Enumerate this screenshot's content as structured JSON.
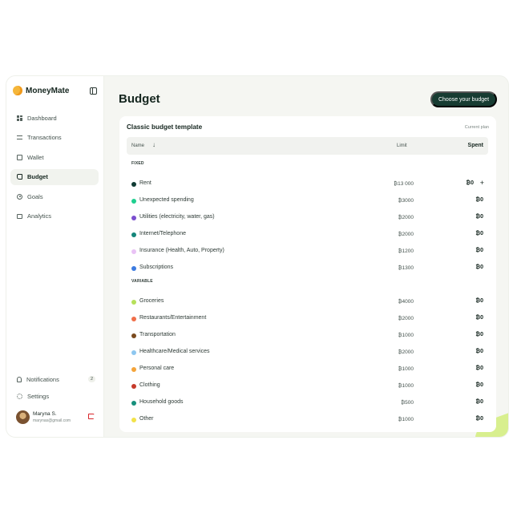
{
  "app": {
    "name": "MoneyMate"
  },
  "sidebar": {
    "items": [
      {
        "label": "Dashboard",
        "icon": "dashboard-icon",
        "active": false
      },
      {
        "label": "Transactions",
        "icon": "transactions-icon",
        "active": false
      },
      {
        "label": "Wallet",
        "icon": "wallet-icon",
        "active": false
      },
      {
        "label": "Budget",
        "icon": "budget-icon",
        "active": true
      },
      {
        "label": "Goals",
        "icon": "goals-icon",
        "active": false
      },
      {
        "label": "Analytics",
        "icon": "analytics-icon",
        "active": false
      }
    ],
    "notifications": {
      "label": "Notifications",
      "count": "2"
    },
    "settings": {
      "label": "Settings"
    },
    "profile": {
      "name": "Maryna S.",
      "email": "marynas@gmail.com"
    }
  },
  "header": {
    "title": "Budget",
    "cta_label": "Choose your budget"
  },
  "card": {
    "title": "Classic budget template",
    "plan_label": "Current plan",
    "columns": {
      "name": "Name",
      "sort_icon": "↓",
      "limit": "Limit",
      "spent": "Spent"
    },
    "sections": [
      {
        "label": "FIXED",
        "rows": [
          {
            "name": "Rent",
            "limit": "₿13 000",
            "spent": "₿0",
            "color": "#0f3b33",
            "add": "+"
          },
          {
            "name": "Unexpected spending",
            "limit": "₿3000",
            "spent": "₿0",
            "color": "#1fcf8f"
          },
          {
            "name": "Utilities (electricity, water, gas)",
            "limit": "₿2000",
            "spent": "₿0",
            "color": "#7b4fcf"
          },
          {
            "name": "Internet/Telephone",
            "limit": "₿2000",
            "spent": "₿0",
            "color": "#14857a"
          },
          {
            "name": "Insurance (Health, Auto, Property)",
            "limit": "₿1200",
            "spent": "₿0",
            "color": "#e9c2f5"
          },
          {
            "name": "Subscriptions",
            "limit": "₿1300",
            "spent": "₿0",
            "color": "#3c7be0"
          }
        ]
      },
      {
        "label": "VARIABLE",
        "rows": [
          {
            "name": "Groceries",
            "limit": "₿4000",
            "spent": "₿0",
            "color": "#b6e05a"
          },
          {
            "name": "Restaurants/Entertainment",
            "limit": "₿2000",
            "spent": "₿0",
            "color": "#f06f4a"
          },
          {
            "name": "Transportation",
            "limit": "₿1000",
            "spent": "₿0",
            "color": "#7a4a1e"
          },
          {
            "name": "Healthcare/Medical services",
            "limit": "₿2000",
            "spent": "₿0",
            "color": "#8ec7f0"
          },
          {
            "name": "Personal care",
            "limit": "₿1000",
            "spent": "₿0",
            "color": "#f4a43a"
          },
          {
            "name": "Clothing",
            "limit": "₿1000",
            "spent": "₿0",
            "color": "#c63a2a"
          },
          {
            "name": "Household goods",
            "limit": "₿500",
            "spent": "₿0",
            "color": "#17907c"
          },
          {
            "name": "Other",
            "limit": "₿1000",
            "spent": "₿0",
            "color": "#f2e24a"
          }
        ]
      }
    ]
  }
}
